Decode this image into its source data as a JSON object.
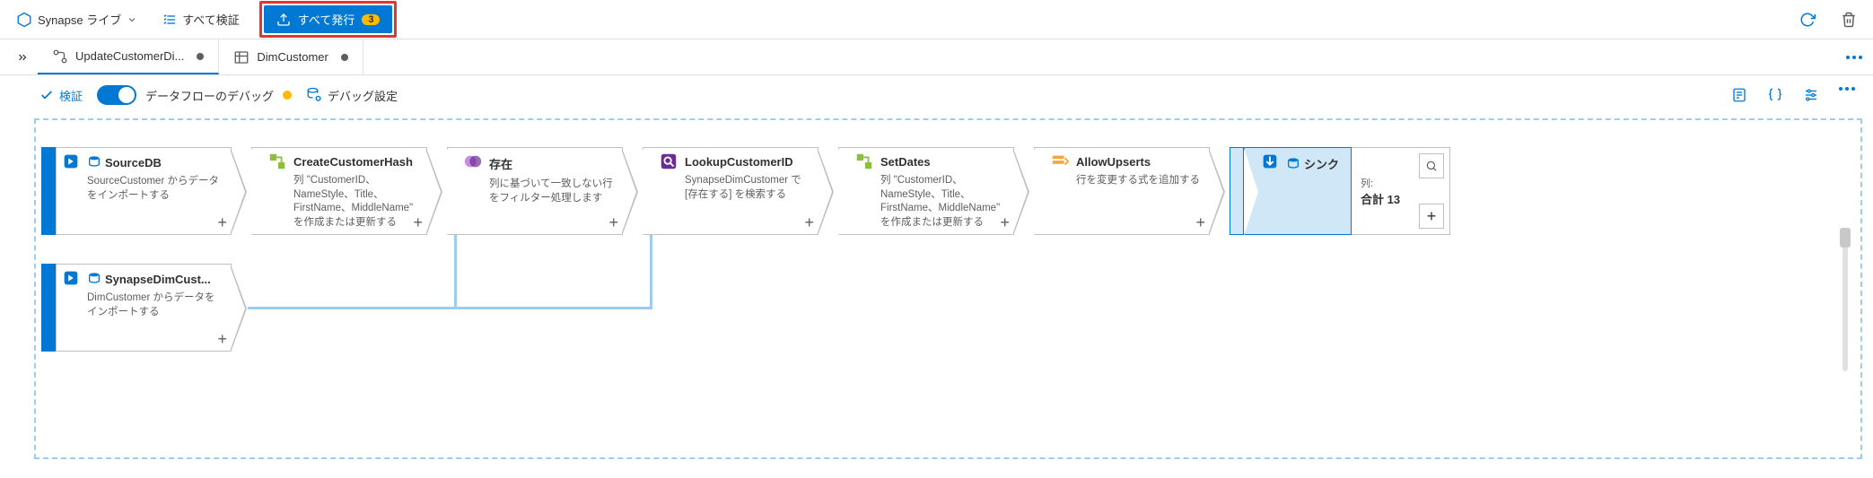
{
  "toolbar": {
    "workspace_label": "Synapse ライブ",
    "validate_all_label": "すべて検証",
    "publish_all_label": "すべて発行",
    "publish_count": "3"
  },
  "tabs": [
    {
      "label": "UpdateCustomerDi...",
      "dirty": true,
      "active": true,
      "icon": "dataflow"
    },
    {
      "label": "DimCustomer",
      "dirty": true,
      "active": false,
      "icon": "table"
    }
  ],
  "actions": {
    "validate_label": "検証",
    "debug_toggle_label": "データフローのデバッグ",
    "debug_settings_label": "デバッグ設定"
  },
  "nodes": {
    "sourceDB": {
      "title": "SourceDB",
      "desc": "SourceCustomer からデータをインポートする"
    },
    "createHash": {
      "title": "CreateCustomerHash",
      "desc": "列 \"CustomerID、NameStyle、Title、FirstName、MiddleName\" を作成または更新する"
    },
    "exists": {
      "title": "存在",
      "desc": "列に基づいて一致しない行をフィルター処理します"
    },
    "lookup": {
      "title": "LookupCustomerID",
      "desc": "SynapseDimCustomer で [存在する] を検索する"
    },
    "setDates": {
      "title": "SetDates",
      "desc": "列 \"CustomerID、NameStyle、Title、FirstName、MiddleName\" を作成または更新する"
    },
    "allowUpserts": {
      "title": "AllowUpserts",
      "desc": "行を変更する式を追加する"
    },
    "sink": {
      "title": "シンク",
      "columns_label": "列:",
      "columns_value": "合計 13"
    },
    "synapseDim": {
      "title": "SynapseDimCust...",
      "desc": "DimCustomer からデータをインポートする"
    }
  }
}
